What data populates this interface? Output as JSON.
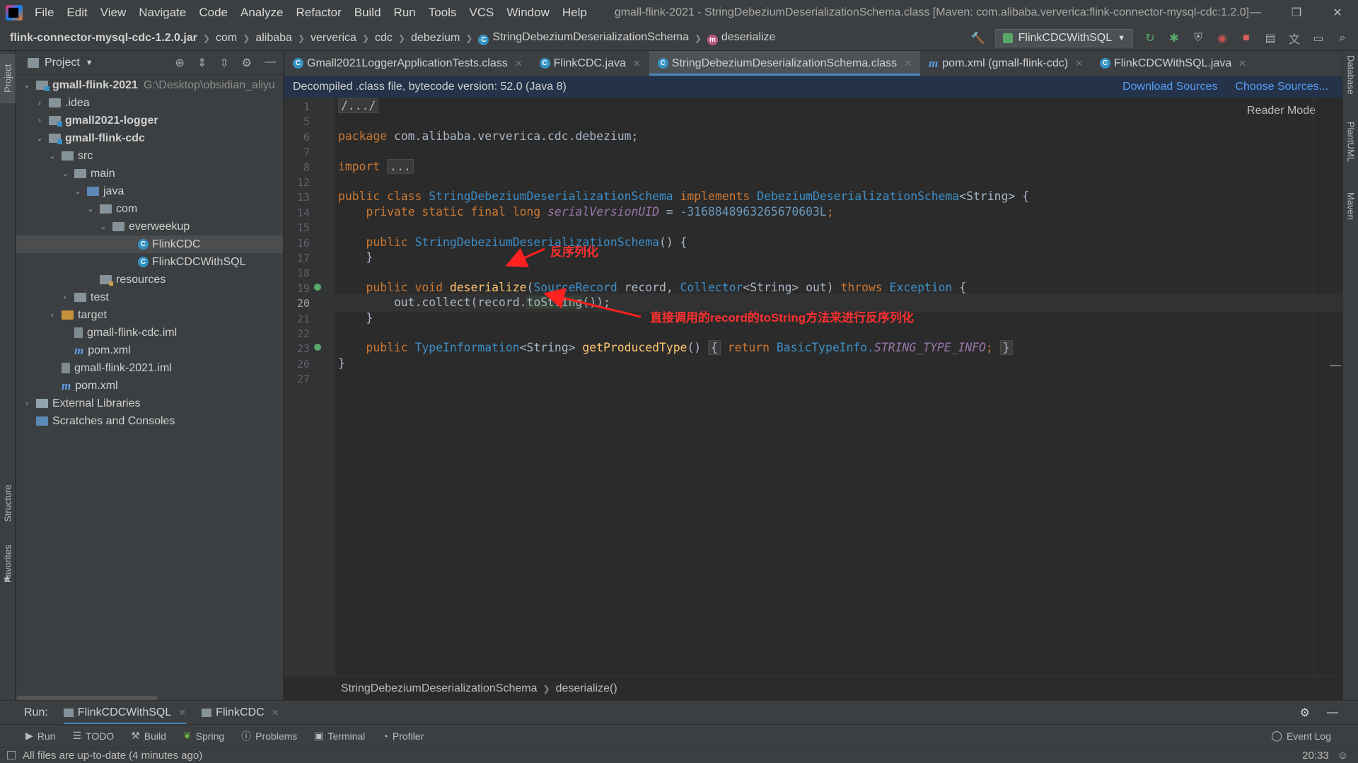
{
  "menu": [
    "File",
    "Edit",
    "View",
    "Navigate",
    "Code",
    "Analyze",
    "Refactor",
    "Build",
    "Run",
    "Tools",
    "VCS",
    "Window",
    "Help"
  ],
  "window_title": "gmall-flink-2021 - StringDebeziumDeserializationSchema.class [Maven: com.alibaba.ververica:flink-connector-mysql-cdc:1.2.0]",
  "breadcrumb": {
    "jar": "flink-connector-mysql-cdc-1.2.0.jar",
    "parts": [
      "com",
      "alibaba",
      "ververica",
      "cdc",
      "debezium"
    ],
    "class_name": "StringDebeziumDeserializationSchema",
    "method": "deserialize"
  },
  "run_config": "FlinkCDCWithSQL",
  "project_panel": {
    "title": "Project",
    "tree": [
      {
        "label": "gmall-flink-2021",
        "path": "G:\\Desktop\\obsidian_aliyu",
        "bold": true,
        "indent": 0,
        "icon": "module-folder",
        "arrow": "down"
      },
      {
        "label": ".idea",
        "indent": 1,
        "icon": "folder",
        "arrow": "right"
      },
      {
        "label": "gmall2021-logger",
        "bold": true,
        "indent": 1,
        "icon": "module-folder",
        "arrow": "right"
      },
      {
        "label": "gmall-flink-cdc",
        "bold": true,
        "indent": 1,
        "icon": "module-folder",
        "arrow": "down"
      },
      {
        "label": "src",
        "indent": 2,
        "icon": "folder",
        "arrow": "down"
      },
      {
        "label": "main",
        "indent": 3,
        "icon": "folder",
        "arrow": "down"
      },
      {
        "label": "java",
        "indent": 4,
        "icon": "source-folder",
        "arrow": "down"
      },
      {
        "label": "com",
        "indent": 5,
        "icon": "package",
        "arrow": "down"
      },
      {
        "label": "everweekup",
        "indent": 6,
        "icon": "package",
        "arrow": "down"
      },
      {
        "label": "FlinkCDC",
        "indent": 8,
        "icon": "class",
        "selected": true
      },
      {
        "label": "FlinkCDCWithSQL",
        "indent": 8,
        "icon": "class"
      },
      {
        "label": "resources",
        "indent": 5,
        "icon": "resources-folder"
      },
      {
        "label": "test",
        "indent": 3,
        "icon": "folder",
        "arrow": "right"
      },
      {
        "label": "target",
        "indent": 2,
        "icon": "target-folder",
        "arrow": "right"
      },
      {
        "label": "gmall-flink-cdc.iml",
        "indent": 3,
        "icon": "iml"
      },
      {
        "label": "pom.xml",
        "indent": 3,
        "icon": "maven"
      },
      {
        "label": "gmall-flink-2021.iml",
        "indent": 2,
        "icon": "iml"
      },
      {
        "label": "pom.xml",
        "indent": 2,
        "icon": "maven"
      },
      {
        "label": "External Libraries",
        "indent": 0,
        "icon": "libraries",
        "arrow": "right"
      },
      {
        "label": "Scratches and Consoles",
        "indent": 0,
        "icon": "scratches"
      }
    ]
  },
  "editor_tabs": [
    {
      "label": "Gmall2021LoggerApplicationTests.class",
      "icon": "class"
    },
    {
      "label": "FlinkCDC.java",
      "icon": "class"
    },
    {
      "label": "StringDebeziumDeserializationSchema.class",
      "icon": "class",
      "active": true
    },
    {
      "label": "pom.xml (gmall-flink-cdc)",
      "icon": "maven"
    },
    {
      "label": "FlinkCDCWithSQL.java",
      "icon": "class"
    }
  ],
  "banner": {
    "text": "Decompiled .class file, bytecode version: 52.0 (Java 8)",
    "download": "Download Sources",
    "choose": "Choose Sources..."
  },
  "reader_mode": "Reader Mode",
  "line_numbers": [
    "1",
    "5",
    "6",
    "7",
    "8",
    "12",
    "13",
    "14",
    "15",
    "16",
    "17",
    "18",
    "19",
    "20",
    "21",
    "22",
    "23",
    "26",
    "27"
  ],
  "current_line": "20",
  "code": {
    "l1": "/.../",
    "l6_kw": "package",
    "l6_pkg": " com.alibaba.ververica.cdc.debezium;",
    "l8_kw": "import",
    "l8_fold": "...",
    "l13_kw1": "public class ",
    "l13_cls": "StringDebeziumDeserializationSchema",
    "l13_kw2": " implements ",
    "l13_iface": "DebeziumDeserializationSchema",
    "l13_rest": "<String> {",
    "l14_kw": "    private static final long ",
    "l14_fld": "serialVersionUID",
    "l14_eq": " = ",
    "l14_num": "-3168848963265670603L",
    "l14_end": ";",
    "l16_kw": "    public ",
    "l16_ctor": "StringDebeziumDeserializationSchema",
    "l16_rest": "() {",
    "l17": "    }",
    "l19_kw": "    public void ",
    "l19_meth": "deserialize",
    "l19_p1": "(",
    "l19_t1": "SourceRecord",
    "l19_p2": " record, ",
    "l19_t2": "Collector",
    "l19_p3": "<String> out) ",
    "l19_kw2": "throws ",
    "l19_t3": "Exception",
    "l19_end": " {",
    "l20_a": "        out.",
    "l20_call": "collect",
    "l20_b": "(record.",
    "l20_hl": "toString",
    "l20_c": "());",
    "l21": "    }",
    "l23_kw": "    public ",
    "l23_t": "TypeInformation",
    "l23_p": "<String> ",
    "l23_meth": "getProducedType",
    "l23_b": "() ",
    "l23_f1": "{",
    "l23_ret": " return ",
    "l23_cls": "BasicTypeInfo.",
    "l23_fld": "STRING_TYPE_INFO",
    "l23_semi": ";",
    "l23_f2": "}",
    "l26": "}"
  },
  "annotations": {
    "deserialize_note": "反序列化",
    "tostring_note": "直接调用的record的toString方法来进行反序列化"
  },
  "editor_breadcrumb": [
    "StringDebeziumDeserializationSchema",
    "deserialize()"
  ],
  "run_bar": {
    "label": "Run:",
    "tabs": [
      "FlinkCDCWithSQL",
      "FlinkCDC"
    ]
  },
  "tool_windows": [
    "Run",
    "TODO",
    "Build",
    "Spring",
    "Problems",
    "Terminal",
    "Profiler"
  ],
  "event_log": "Event Log",
  "left_strip": [
    "Project",
    "Structure",
    "Favorites"
  ],
  "right_strip": [
    "Database",
    "PlantUML",
    "Maven"
  ],
  "status": {
    "message": "All files are up-to-date (4 minutes ago)",
    "time": "20:33"
  },
  "colors": {
    "keyword": "#cc7832",
    "type": "#3d8fc9",
    "method": "#ffc66d",
    "field": "#9876aa",
    "number": "#6897bb",
    "annotation": "#ff3030",
    "accent": "#4a88c7"
  }
}
